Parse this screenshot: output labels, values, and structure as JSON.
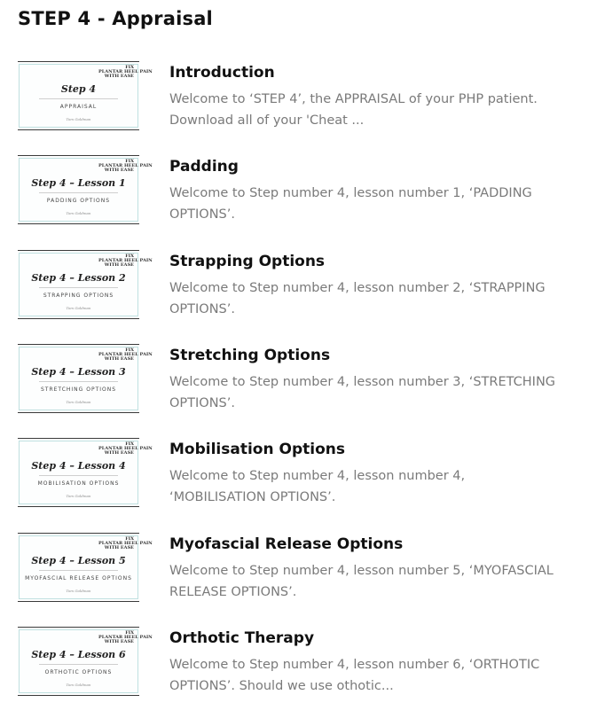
{
  "page": {
    "title": "STEP 4 - Appraisal"
  },
  "lessons": [
    {
      "title": "Introduction",
      "description": "Welcome to ‘STEP 4’, the APPRAISAL of your PHP patient. Download all of your 'Cheat ...",
      "thumb_title": "Step 4",
      "thumb_subtitle": "APPRAISAL"
    },
    {
      "title": "Padding",
      "description": "Welcome to Step number 4, lesson number 1, ‘PADDING OPTIONS’.",
      "thumb_title": "Step 4 – Lesson 1",
      "thumb_subtitle": "PADDING OPTIONS"
    },
    {
      "title": "Strapping Options",
      "description": "Welcome to Step number 4, lesson number 2, ‘STRAPPING OPTIONS’.",
      "thumb_title": "Step 4 – Lesson 2",
      "thumb_subtitle": "STRAPPING OPTIONS"
    },
    {
      "title": "Stretching Options",
      "description": "Welcome to Step number 4, lesson number 3, ‘STRETCHING OPTIONS’.",
      "thumb_title": "Step 4 – Lesson 3",
      "thumb_subtitle": "STRETCHING OPTIONS"
    },
    {
      "title": "Mobilisation Options",
      "description": "Welcome to Step number 4, lesson number 4, ‘MOBILISATION OPTIONS’.",
      "thumb_title": "Step 4 – Lesson 4",
      "thumb_subtitle": "MOBILISATION OPTIONS"
    },
    {
      "title": "Myofascial Release Options",
      "description": "Welcome to Step number 4, lesson number 5, ‘MYOFASCIAL RELEASE OPTIONS’.",
      "thumb_title": "Step 4 – Lesson 5",
      "thumb_subtitle": "MYOFASCIAL RELEASE OPTIONS"
    },
    {
      "title": "Orthotic Therapy",
      "description": "Welcome to Step number 4, lesson number 6, ‘ORTHOTIC OPTIONS’. Should we use othotic...",
      "thumb_title": "Step 4 – Lesson 6",
      "thumb_subtitle": "ORTHOTIC OPTIONS"
    }
  ],
  "thumbnail_brand": {
    "line1": "FIX",
    "line2": "PLANTAR HEEL PAIN",
    "line3": "WITH EASE",
    "signature": "Tom Goldman"
  },
  "colors": {
    "title": "#111111",
    "description": "#7a7a7a",
    "thumb_border": "#bfe0e0"
  }
}
